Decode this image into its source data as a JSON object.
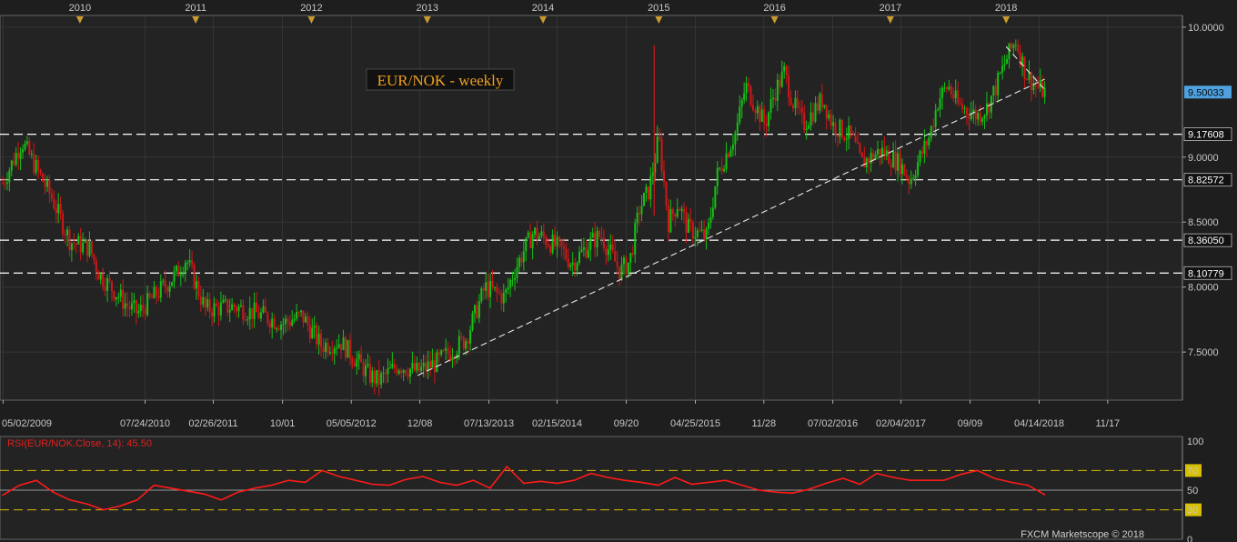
{
  "chart_data": [
    {
      "type": "candlestick",
      "title": "EUR/NOK - weekly",
      "y_range": [
        7.13,
        10.09
      ],
      "y_ticks": [
        "10.0000",
        "9.0000",
        "8.5000",
        "8.0000",
        "7.5000"
      ],
      "current_price": "9.50033",
      "year_labels": [
        "2010",
        "2011",
        "2012",
        "2013",
        "2014",
        "2015",
        "2016",
        "2017",
        "2018"
      ],
      "date_labels": [
        "05/02/2009",
        "07/24/2010",
        "02/26/2011",
        "10/01",
        "05/05/2012",
        "12/08",
        "07/13/2013",
        "02/15/2014",
        "09/20",
        "04/25/2015",
        "11/28",
        "07/02/2016",
        "02/04/2017",
        "09/09",
        "04/14/2018",
        "11/17"
      ],
      "horizontal_levels": [
        {
          "value": 9.17608,
          "label": "9.17608"
        },
        {
          "value": 8.82572,
          "label": "8.82572"
        },
        {
          "value": 8.3605,
          "label": "8.36050"
        },
        {
          "value": 8.10779,
          "label": "8.10779"
        }
      ],
      "trendlines": [
        {
          "style": "dashed",
          "from": [
            "12/2012",
            7.32
          ],
          "to": [
            "05/2018",
            9.6
          ]
        },
        {
          "style": "dashed",
          "from": [
            "01/2018",
            9.85
          ],
          "to": [
            "05/2018",
            9.52
          ]
        }
      ],
      "price_path": [
        [
          "05/2009",
          8.8
        ],
        [
          "07/2009",
          9.12
        ],
        [
          "10/2009",
          8.7
        ],
        [
          "12/2009",
          8.35
        ],
        [
          "02/2010",
          8.3
        ],
        [
          "03/2010",
          8.1
        ],
        [
          "06/2010",
          7.85
        ],
        [
          "07/2010",
          7.8
        ],
        [
          "09/2010",
          7.95
        ],
        [
          "11/2010",
          8.1
        ],
        [
          "12/2010",
          8.22
        ],
        [
          "02/2011",
          7.83
        ],
        [
          "05/2011",
          7.85
        ],
        [
          "08/2011",
          7.78
        ],
        [
          "10/2011",
          7.72
        ],
        [
          "12/2011",
          7.78
        ],
        [
          "02/2012",
          7.55
        ],
        [
          "04/2012",
          7.58
        ],
        [
          "07/2012",
          7.32
        ],
        [
          "08/2012",
          7.28
        ],
        [
          "10/2012",
          7.4
        ],
        [
          "12/2012",
          7.35
        ],
        [
          "02/2013",
          7.42
        ],
        [
          "05/2013",
          7.6
        ],
        [
          "07/2013",
          8.0
        ],
        [
          "09/2013",
          7.92
        ],
        [
          "10/2013",
          8.12
        ],
        [
          "11/2013",
          8.28
        ],
        [
          "12/2013",
          8.42
        ],
        [
          "01/2014",
          8.38
        ],
        [
          "03/2014",
          8.28
        ],
        [
          "04/2014",
          8.18
        ],
        [
          "06/2014",
          8.35
        ],
        [
          "07/2014",
          8.4
        ],
        [
          "09/2014",
          8.12
        ],
        [
          "10/2014",
          8.2
        ],
        [
          "11/2014",
          8.6
        ],
        [
          "12/2014",
          8.75
        ],
        [
          "01/2015",
          9.15
        ],
        [
          "02/2015",
          8.5
        ],
        [
          "03/2015",
          8.65
        ],
        [
          "04/2015",
          8.45
        ],
        [
          "06/2015",
          8.38
        ],
        [
          "07/2015",
          8.85
        ],
        [
          "09/2015",
          9.2
        ],
        [
          "10/2015",
          9.55
        ],
        [
          "12/2015",
          9.25
        ],
        [
          "01/2016",
          9.5
        ],
        [
          "02/2016",
          9.65
        ],
        [
          "03/2016",
          9.4
        ],
        [
          "04/2016",
          9.25
        ],
        [
          "06/2016",
          9.45
        ],
        [
          "07/2016",
          9.25
        ],
        [
          "09/2016",
          9.15
        ],
        [
          "10/2016",
          8.95
        ],
        [
          "12/2016",
          9.05
        ],
        [
          "02/2017",
          8.95
        ],
        [
          "03/2017",
          8.82
        ],
        [
          "05/2017",
          9.15
        ],
        [
          "06/2017",
          9.45
        ],
        [
          "07/2017",
          9.55
        ],
        [
          "08/2017",
          9.4
        ],
        [
          "10/2017",
          9.32
        ],
        [
          "11/2017",
          9.38
        ],
        [
          "12/2017",
          9.55
        ],
        [
          "01/2018",
          9.75
        ],
        [
          "02/2018",
          9.9
        ],
        [
          "03/2018",
          9.65
        ],
        [
          "04/2018",
          9.55
        ],
        [
          "05/2018",
          9.5
        ]
      ]
    },
    {
      "type": "line",
      "title": "RSI(EUR/NOK.Close, 14): 45.50",
      "y_range": [
        0,
        100
      ],
      "y_ticks": [
        "100",
        "70",
        "50",
        "30",
        "0"
      ],
      "reference_levels": [
        70,
        50,
        30
      ],
      "values": [
        45,
        55,
        60,
        48,
        40,
        36,
        30,
        34,
        40,
        55,
        52,
        49,
        46,
        40,
        48,
        52,
        55,
        60,
        58,
        70,
        64,
        60,
        56,
        55,
        61,
        64,
        58,
        55,
        60,
        52,
        74,
        57,
        59,
        57,
        60,
        67,
        63,
        60,
        58,
        55,
        63,
        56,
        58,
        60,
        55,
        50,
        48,
        47,
        51,
        57,
        62,
        56,
        67,
        63,
        60,
        60,
        60,
        66,
        70,
        62,
        58,
        55,
        45.5
      ]
    }
  ],
  "copyright": "FXCM Marketscope © 2018",
  "colors": {
    "background": "#1e1e1e",
    "panel": "#232323",
    "grid": "#3a3a3a",
    "up": "#16c016",
    "down": "#d01818",
    "title_orange": "#f0a020",
    "rsi_line": "#ff1a1a",
    "rsi_levels": "#d8c000",
    "price_tag": "#4ea2e0"
  }
}
